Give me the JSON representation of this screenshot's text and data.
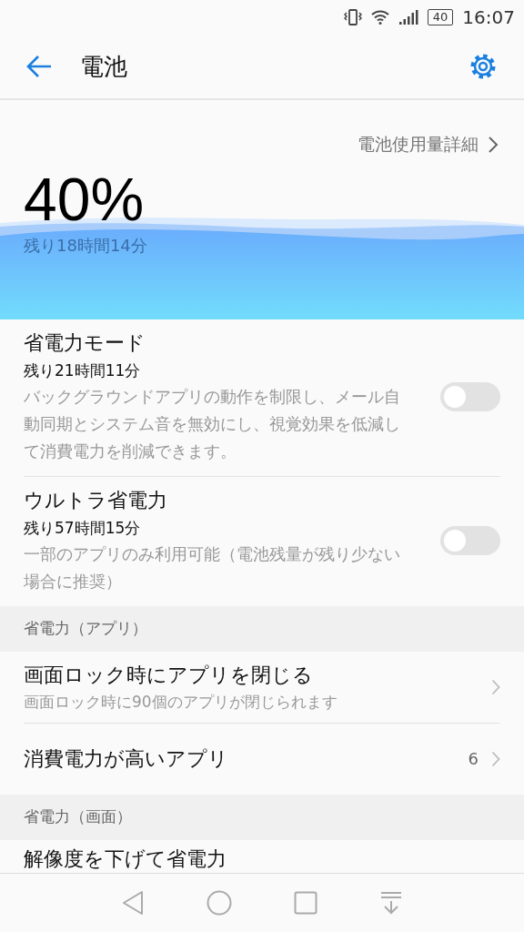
{
  "status_bar": {
    "battery": "40",
    "time": "16:07"
  },
  "header": {
    "title": "電池"
  },
  "battery": {
    "detail_link": "電池使用量詳細",
    "percent": "40%",
    "remaining": "残り18時間14分"
  },
  "modes": [
    {
      "title": "省電力モード",
      "remaining": "残り21時間11分",
      "description": "バックグラウンドアプリの動作を制限し、メール自動同期とシステム音を無効にし、視覚効果を低減して消費電力を削減できます。",
      "on": false
    },
    {
      "title": "ウルトラ省電力",
      "remaining": "残り57時間15分",
      "description": "一部のアプリのみ利用可能（電池残量が残り少ない場合に推奨）",
      "on": false
    }
  ],
  "sections": [
    {
      "title": "省電力（アプリ）",
      "items": [
        {
          "title": "画面ロック時にアプリを閉じる",
          "subtitle": "画面ロック時に90個のアプリが閉じられます"
        },
        {
          "title": "消費電力が高いアプリ",
          "count": "6"
        }
      ]
    },
    {
      "title": "省電力（画面）",
      "items": [
        {
          "title": "解像度を下げて省電力"
        }
      ]
    }
  ]
}
